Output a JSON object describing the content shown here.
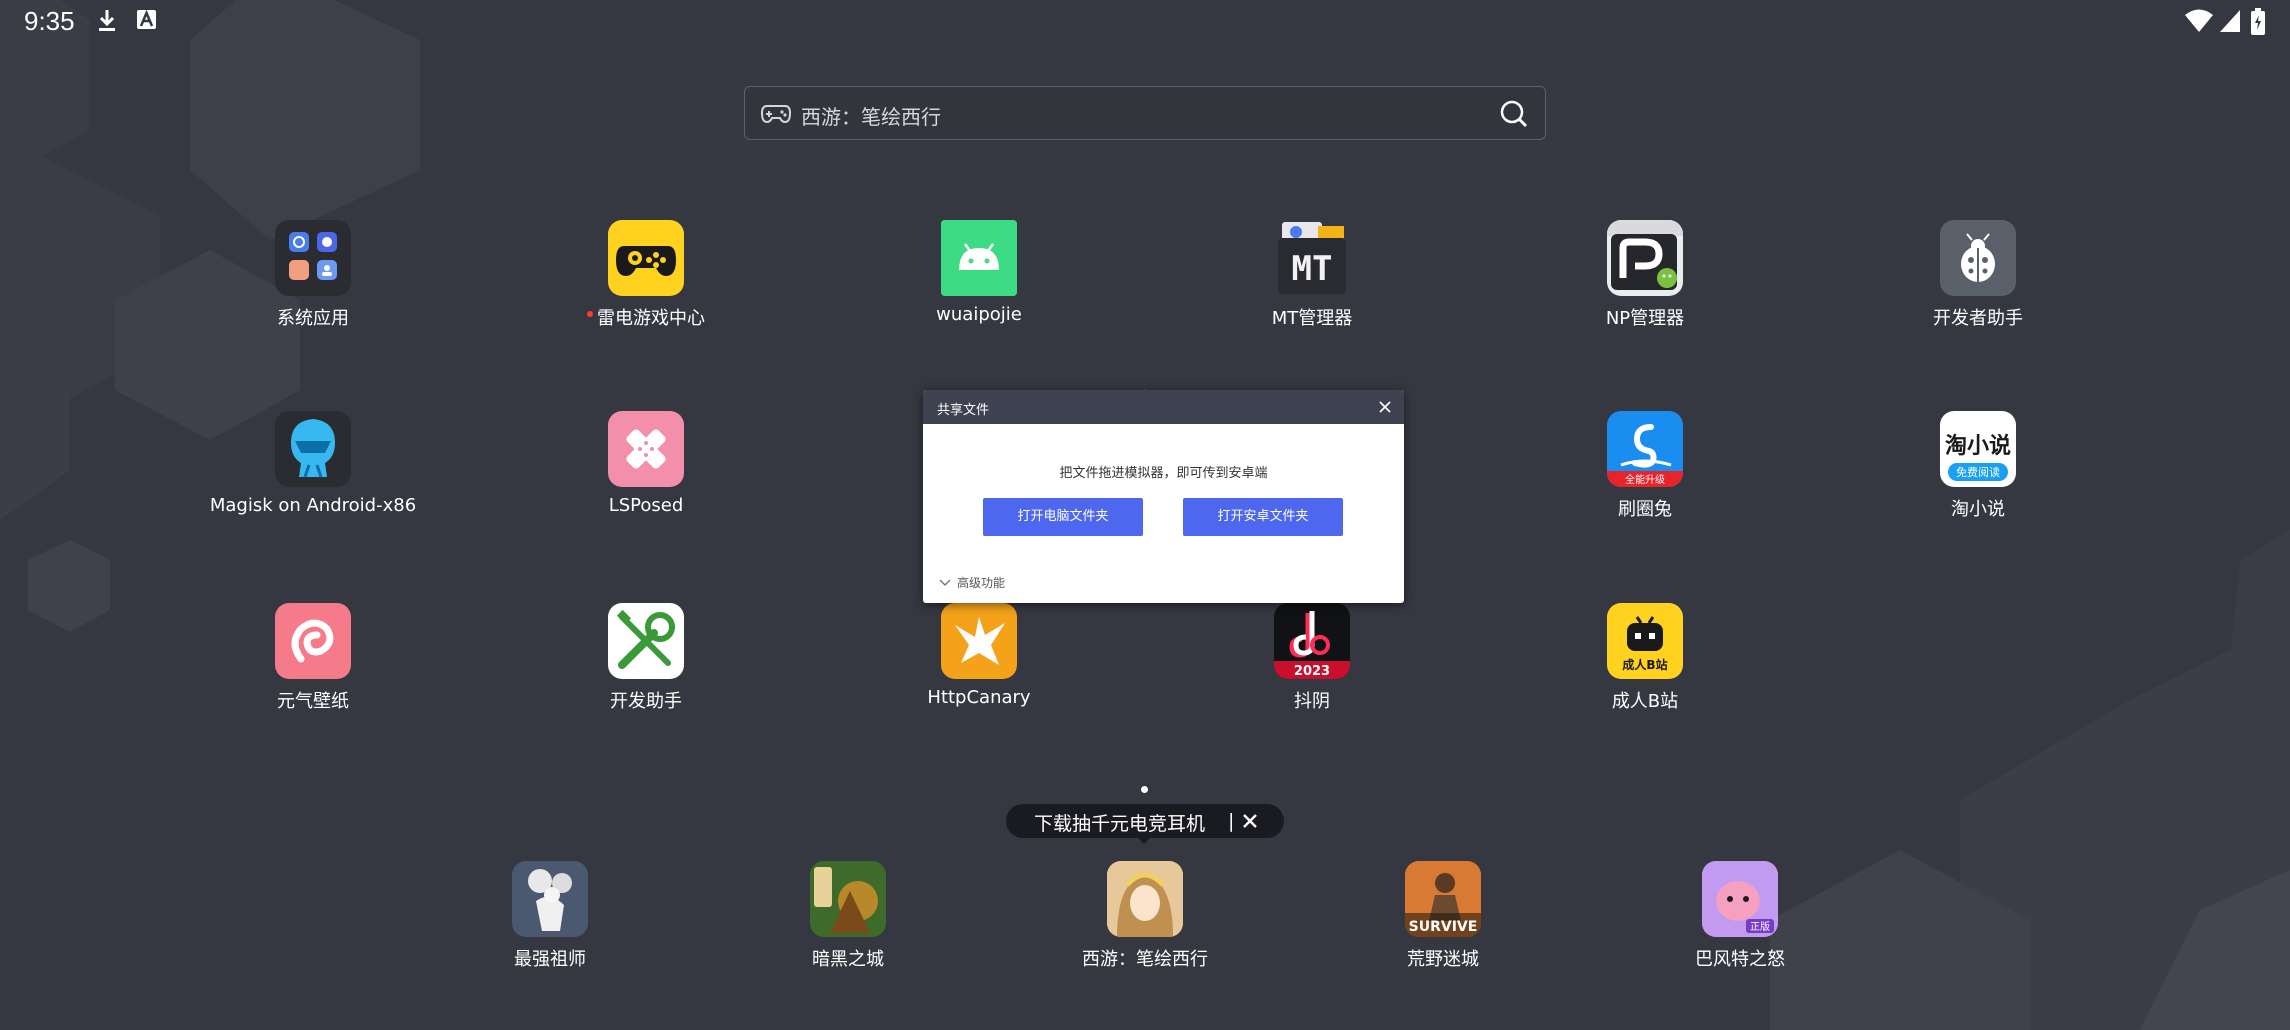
{
  "status_bar": {
    "time": "9:35",
    "left_icons": [
      "download-icon",
      "a-badge-icon"
    ],
    "right_icons": [
      "wifi-icon",
      "signal-icon",
      "battery-icon"
    ]
  },
  "search": {
    "text": "西游：笔绘西行",
    "left_icon": "gamepad-icon",
    "right_icon": "search-icon"
  },
  "apps": [
    {
      "label": "系统应用",
      "icon": "folder-icon",
      "new_dot": false
    },
    {
      "label": "雷电游戏中心",
      "icon": "controller-icon",
      "new_dot": true
    },
    {
      "label": "wuaipojie",
      "icon": "android-icon",
      "new_dot": false
    },
    {
      "label": "MT管理器",
      "icon": "mt-icon",
      "new_dot": false
    },
    {
      "label": "NP管理器",
      "icon": "np-icon",
      "new_dot": false
    },
    {
      "label": "开发者助手",
      "icon": "ladybug-icon",
      "new_dot": false
    },
    {
      "label": "Magisk on Android-x86",
      "icon": "magisk-icon",
      "new_dot": false
    },
    {
      "label": "LSPosed",
      "icon": "lsposed-icon",
      "new_dot": false
    },
    {
      "label": "刷圈兔",
      "icon": "shuaquantu-icon",
      "new_dot": false
    },
    {
      "label": "淘小说",
      "icon": "taoxiaoshuo-icon",
      "new_dot": false
    },
    {
      "label": "元气壁纸",
      "icon": "yuanqi-icon",
      "new_dot": false
    },
    {
      "label": "开发助手",
      "icon": "wrench-icon",
      "new_dot": false
    },
    {
      "label": "HttpCanary",
      "icon": "canary-icon",
      "new_dot": false
    },
    {
      "label": "抖阴",
      "icon": "douyin-icon",
      "new_dot": false
    },
    {
      "label": "成人B站",
      "icon": "bilibili-icon",
      "new_dot": false
    }
  ],
  "app_badges": {
    "shuaquantu": "全能升级",
    "taoxiaoshuo_top": "淘小说",
    "taoxiaoshuo_bottom": "免费阅读",
    "douyin": "2023",
    "bilibili": "成人B站",
    "mt": "MT"
  },
  "dialog": {
    "title": "共享文件",
    "message": "把文件拖进模拟器，即可传到安卓端",
    "button_pc": "打开电脑文件夹",
    "button_android": "打开安卓文件夹",
    "advanced": "高级功能"
  },
  "promo": {
    "text": "下载抽千元电竞耳机",
    "separator": "|",
    "close": "✕"
  },
  "dock": [
    {
      "label": "最强祖师",
      "icon": "zuishi-icon"
    },
    {
      "label": "暗黑之城",
      "icon": "anhei-icon"
    },
    {
      "label": "西游：笔绘西行",
      "icon": "xiyou-icon"
    },
    {
      "label": "荒野迷城",
      "icon": "survive-icon"
    },
    {
      "label": "巴风特之怒",
      "icon": "bafengte-icon"
    }
  ],
  "dock_badges": {
    "survive": "SURVIVE",
    "bafengte": "正版"
  },
  "colors": {
    "background": "#363841",
    "dialog_button": "#4d68ee",
    "dialog_title_bar": "#3f4351",
    "arrow": "#e8261c"
  }
}
